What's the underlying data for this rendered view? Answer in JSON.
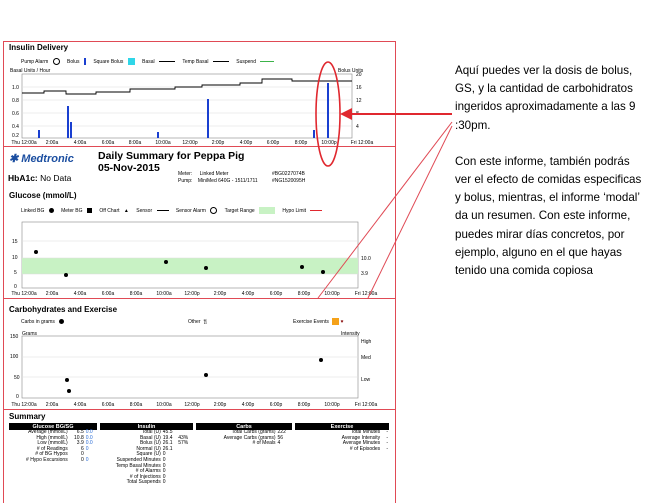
{
  "insulin": {
    "title": "Insulin Delivery",
    "legend": {
      "pump_alarm": "Pump Alarm",
      "bolus": "Bolus",
      "square_bolus": "Square Bolus",
      "basal": "Basal",
      "temp_basal": "Temp Basal",
      "suspend": "Suspend"
    },
    "left_axis_label": "Basal Units / Hour",
    "right_axis_label": "Bolus Units",
    "y_ticks": [
      "1.0",
      "0.8",
      "0.6",
      "0.4",
      "0.2"
    ],
    "x_ticks": [
      "Thu 12:00a",
      "2:00a",
      "4:00a",
      "6:00a",
      "8:00a",
      "10:00a",
      "12:00p",
      "2:00p",
      "4:00p",
      "6:00p",
      "8:00p",
      "10:00p",
      "Fri 12:00a"
    ]
  },
  "report": {
    "brand": "Medtronic",
    "title": "Daily Summary for Peppa Pig",
    "date": "05-Nov-2015",
    "meter_label": "Meter:",
    "meter_value": "Linked Meter",
    "meter_serial": "#BG0227074B",
    "pump_label": "Pump:",
    "pump_value": "MiniMed 640G - 1511/1711",
    "pump_serial": "#NG1520095H",
    "hba1c_label": "HbA1c:",
    "hba1c_value": "No Data"
  },
  "glucose": {
    "title": "Glucose (mmol/L)",
    "legend": {
      "linked_bg": "Linked BG",
      "meter_bg": "Meter BG",
      "off_chart": "Off Chart",
      "sensor": "Sensor",
      "sensor_alarm": "Sensor Alarm",
      "target_range": "Target Range",
      "hypo_limit": "Hypo Limit"
    },
    "y_ticks": [
      "15",
      "10",
      "5",
      "0"
    ],
    "right_ticks": [
      "10.0",
      "3.9"
    ],
    "x_ticks": [
      "Thu 12:00a",
      "2:00a",
      "4:00a",
      "6:00a",
      "8:00a",
      "10:00a",
      "12:00p",
      "2:00p",
      "4:00p",
      "6:00p",
      "8:00p",
      "10:00p",
      "Fri 12:00a"
    ]
  },
  "carbs": {
    "title": "Carbohydrates and Exercise",
    "legend": {
      "carbs_in_grams": "Carbs in grams",
      "other": "Other",
      "exercise_events": "Exercise Events"
    },
    "left_axis_label": "Grams",
    "right_axis_label": "Intensity",
    "y_ticks": [
      "150",
      "100",
      "50",
      "0"
    ],
    "intensity_ticks": [
      "High",
      "Med",
      "Low"
    ],
    "x_ticks": [
      "Thu 12:00a",
      "2:00a",
      "4:00a",
      "6:00a",
      "8:00a",
      "10:00a",
      "12:00p",
      "2:00p",
      "4:00p",
      "6:00p",
      "8:00p",
      "10:00p",
      "Fri 12:00a"
    ]
  },
  "summary": {
    "title": "Summary",
    "headers": [
      "Glucose BG/SG",
      "Insulin",
      "Carbs",
      "Exercise"
    ],
    "glucose_rows": [
      {
        "label": "Average (mmol/L)",
        "v1": "6.5",
        "v2": "0.0"
      },
      {
        "label": "High (mmol/L)",
        "v1": "10.8",
        "v2": "0.0"
      },
      {
        "label": "Low (mmol/L)",
        "v1": "3.9",
        "v2": "0.0"
      },
      {
        "label": "# of Readings",
        "v1": "6",
        "v2": "0"
      },
      {
        "label": "# of BG Hypos",
        "v1": "0",
        "v2": ""
      },
      {
        "label": "# Hypo Excursions",
        "v1": "0",
        "v2": "0"
      }
    ],
    "insulin_rows": [
      {
        "label": "Total (U)",
        "v1": "45.5",
        "v2": ""
      },
      {
        "label": "Basal (U)",
        "v1": "19.4",
        "v2": "43%"
      },
      {
        "label": "Bolus (U)",
        "v1": "26.1",
        "v2": "57%"
      },
      {
        "label": "Normal (U)",
        "v1": "26.1",
        "v2": ""
      },
      {
        "label": "Square (U)",
        "v1": "0",
        "v2": ""
      },
      {
        "label": "Suspended Minutes",
        "v1": "0",
        "v2": ""
      },
      {
        "label": "Temp Basal Minutes",
        "v1": "0",
        "v2": ""
      },
      {
        "label": "# of Alarms",
        "v1": "0",
        "v2": ""
      },
      {
        "label": "# of Injections",
        "v1": "0",
        "v2": ""
      },
      {
        "label": "Total Suspends",
        "v1": "0",
        "v2": ""
      }
    ],
    "carbs_rows": [
      {
        "label": "Total Carbs (grams)",
        "v1": "222"
      },
      {
        "label": "Average Carbs (grams)",
        "v1": "56"
      },
      {
        "label": "# of Meals",
        "v1": "4"
      }
    ],
    "exercise_rows": [
      {
        "label": "Total Minutes",
        "v1": "-"
      },
      {
        "label": "Average Intensity",
        "v1": "-"
      },
      {
        "label": "Average Minutes",
        "v1": "-"
      },
      {
        "label": "# of Episodes",
        "v1": "-"
      }
    ]
  },
  "annotation": {
    "p1": "Aquí puedes ver la dosis de bolus, GS, y la cantidad de carbohidratos ingeridos aproximadamente a las 9 :30pm.",
    "p2": "Con este informe, también podrás ver el efecto de  comidas especificas y bolus, mientras, el informe ‘modal’ da un resumen. Con este informe, puedes mirar días concretos, por ejemplo, alguno en el que hayas tenido una comida copiosa"
  },
  "colors": {
    "accent_red": "#e0282f",
    "bolus_blue": "#1a3fd0",
    "target_green": "#c8f2c4",
    "square_bolus_cyan": "#2fd6e8",
    "medtronic_blue": "#1b4ea0"
  }
}
